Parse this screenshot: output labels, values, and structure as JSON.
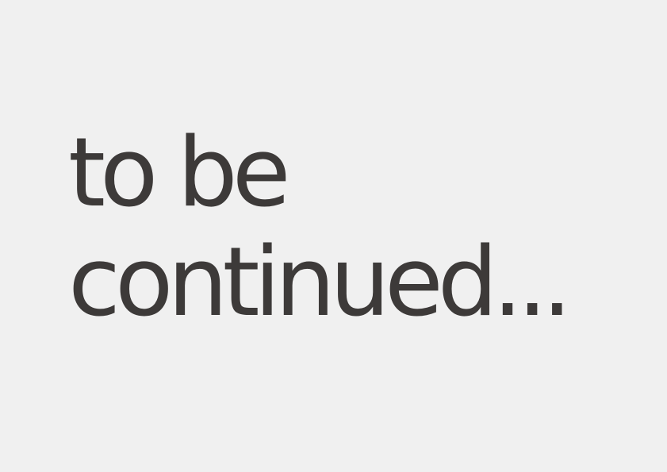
{
  "slide": {
    "text_color": "#3d3a39",
    "background_color": "#f0f0f0",
    "headline": {
      "line1": "to be",
      "line2": "continued..."
    }
  }
}
